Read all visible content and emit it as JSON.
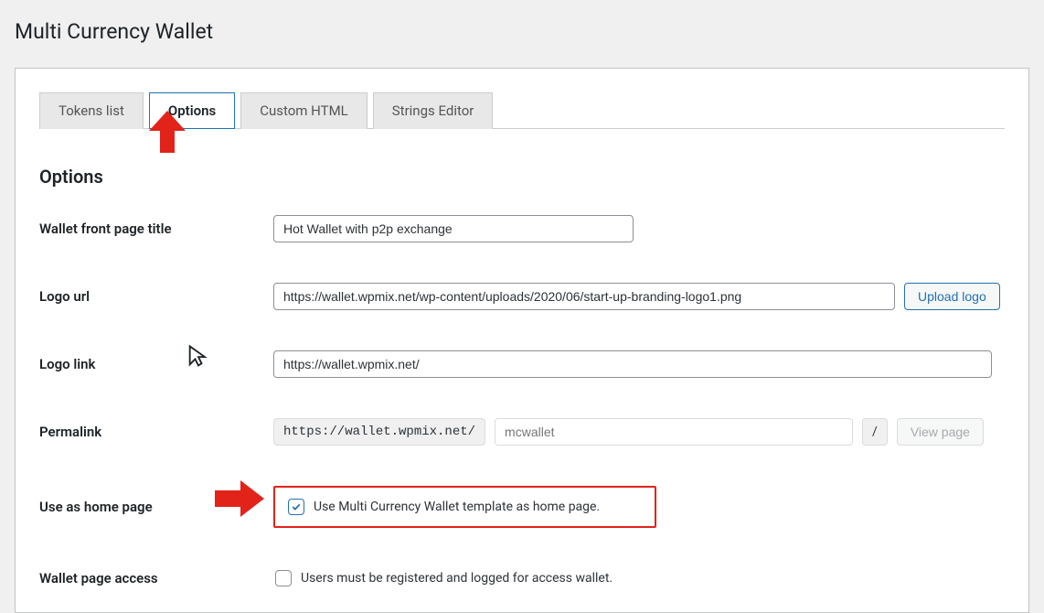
{
  "pageTitle": "Multi Currency Wallet",
  "tabs": {
    "tokens": "Tokens list",
    "options": "Options",
    "custom": "Custom HTML",
    "strings": "Strings Editor"
  },
  "sectionTitle": "Options",
  "fields": {
    "frontTitle": {
      "label": "Wallet front page title",
      "value": "Hot Wallet with p2p exchange"
    },
    "logoUrl": {
      "label": "Logo url",
      "value": "https://wallet.wpmix.net/wp-content/uploads/2020/06/start-up-branding-logo1.png",
      "button": "Upload logo"
    },
    "logoLink": {
      "label": "Logo link",
      "value": "https://wallet.wpmix.net/"
    },
    "permalink": {
      "label": "Permalink",
      "prefix": "https://wallet.wpmix.net/",
      "slug": "mcwallet",
      "slash": "/",
      "view": "View page"
    },
    "homepage": {
      "label": "Use as home page",
      "text": "Use Multi Currency Wallet template as home page."
    },
    "access": {
      "label": "Wallet page access",
      "text": "Users must be registered and logged for access wallet."
    }
  }
}
